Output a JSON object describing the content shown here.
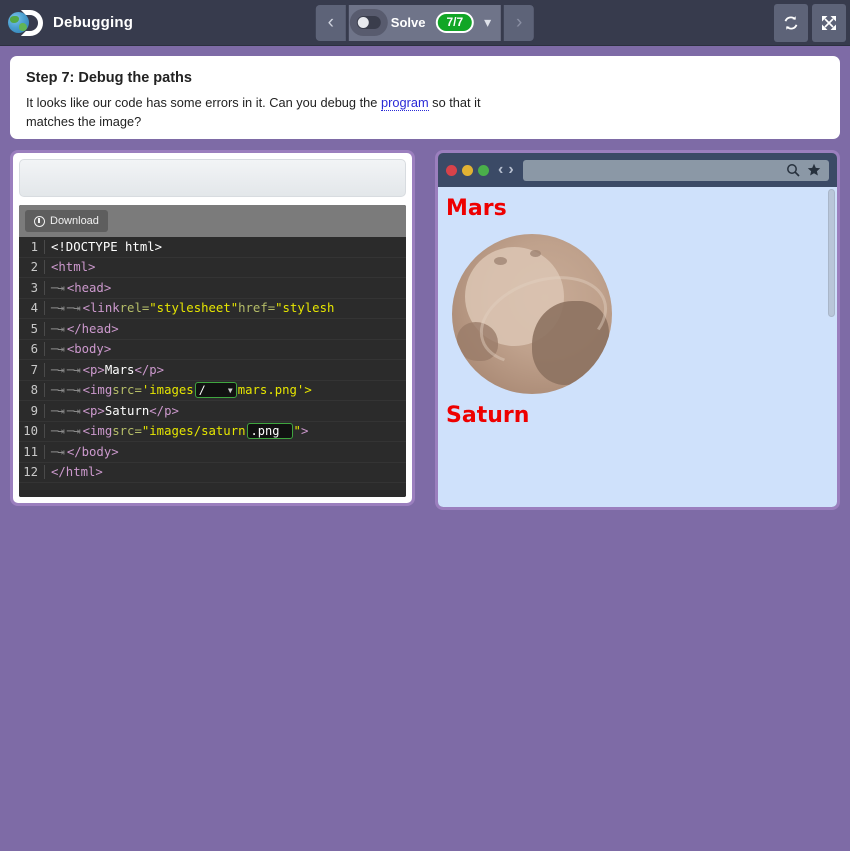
{
  "topbar": {
    "logo_icon": "globe-d-logo-icon",
    "title": "Debugging",
    "nav": {
      "prev_icon": "chevron-left-icon",
      "next_icon": "chevron-right-icon",
      "toggle_icon": "toggle-switch-icon",
      "mode_label": "Solve",
      "counter": "7/7",
      "dropdown_icon": "chevron-down-icon"
    },
    "actions": {
      "refresh_icon": "refresh-icon",
      "fullscreen_icon": "fullscreen-expand-icon"
    }
  },
  "instruction": {
    "heading": "Step 7: Debug the paths",
    "body_before": "It looks like our code has some errors in it. Can you debug the ",
    "link_text": "program",
    "body_after": " so that it matches the image?"
  },
  "editor": {
    "download_label": "Download",
    "download_icon": "download-circle-icon",
    "lines": [
      {
        "num": "1",
        "indent": 0,
        "tokens": [
          {
            "t": "doc",
            "v": "<!DOCTYPE html>"
          }
        ]
      },
      {
        "num": "2",
        "indent": 0,
        "tokens": [
          {
            "t": "tag",
            "v": "<html>"
          }
        ]
      },
      {
        "num": "3",
        "indent": 1,
        "tokens": [
          {
            "t": "tag",
            "v": "<head>"
          }
        ]
      },
      {
        "num": "4",
        "indent": 2,
        "tokens": [
          {
            "t": "tag",
            "v": "<link "
          },
          {
            "t": "attr",
            "v": "rel="
          },
          {
            "t": "str",
            "v": "\"stylesheet\""
          },
          {
            "t": "attr",
            "v": " href="
          },
          {
            "t": "str",
            "v": "\"stylesh"
          }
        ]
      },
      {
        "num": "5",
        "indent": 1,
        "tokens": [
          {
            "t": "tag",
            "v": "</head>"
          }
        ]
      },
      {
        "num": "6",
        "indent": 1,
        "tokens": [
          {
            "t": "tag",
            "v": "<body>"
          }
        ]
      },
      {
        "num": "7",
        "indent": 2,
        "tokens": [
          {
            "t": "tag",
            "v": "<p>"
          },
          {
            "t": "txt",
            "v": "Mars"
          },
          {
            "t": "tag",
            "v": "</p>"
          }
        ]
      },
      {
        "num": "8",
        "indent": 2,
        "widget": "select",
        "tokens": [
          {
            "t": "tag",
            "v": "<img "
          },
          {
            "t": "attr",
            "v": "src="
          },
          {
            "t": "str",
            "v": "'images"
          }
        ],
        "tokens_after": [
          {
            "t": "str",
            "v": "mars.png'>"
          }
        ]
      },
      {
        "num": "9",
        "indent": 2,
        "tokens": [
          {
            "t": "tag",
            "v": "<p>"
          },
          {
            "t": "txt",
            "v": "Saturn"
          },
          {
            "t": "tag",
            "v": "</p>"
          }
        ]
      },
      {
        "num": "10",
        "indent": 2,
        "widget": "input",
        "tokens": [
          {
            "t": "tag",
            "v": "<img "
          },
          {
            "t": "attr",
            "v": "src="
          },
          {
            "t": "str",
            "v": "\"images/saturn"
          }
        ],
        "tokens_after": [
          {
            "t": "str",
            "v": "\""
          },
          {
            "t": "tag",
            "v": ">"
          }
        ]
      },
      {
        "num": "11",
        "indent": 1,
        "tokens": [
          {
            "t": "tag",
            "v": "</body>"
          }
        ]
      },
      {
        "num": "12",
        "indent": 0,
        "tokens": [
          {
            "t": "tag",
            "v": "</html>"
          }
        ]
      }
    ],
    "path_select": {
      "value": "/",
      "options": [
        "/",
        "",
        "\\"
      ]
    },
    "ext_input": {
      "value": ".png"
    }
  },
  "preview": {
    "chrome": {
      "dot_red": "close-dot-icon",
      "dot_yellow": "minimize-dot-icon",
      "dot_green": "maximize-dot-icon",
      "back_icon": "chevron-left-icon",
      "forward_icon": "chevron-right-icon",
      "address_value": "",
      "search_icon": "search-icon",
      "bookmark_icon": "star-icon"
    },
    "headings": {
      "first": "Mars",
      "second": "Saturn"
    },
    "image_alt": "planet-sphere-image"
  },
  "colors": {
    "page_background": "#7e6ba6",
    "topbar": "#373b4d",
    "panel_border": "#9b7fbe",
    "badge_green": "#11a626",
    "heading_red": "#ee0000",
    "link_blue": "#2a2ad6",
    "code_background": "#2b2b2b",
    "widget_outline": "#3fa53f",
    "preview_background": "#cfe1fb"
  }
}
